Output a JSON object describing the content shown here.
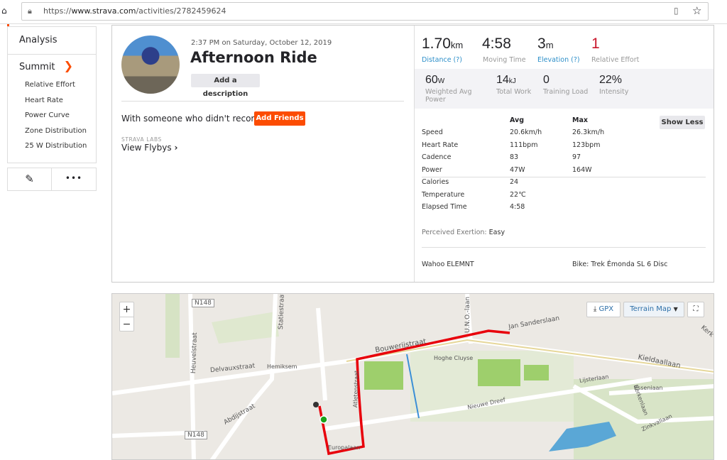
{
  "browser": {
    "url_prefix": "https://",
    "url_domain": "www.strava.com",
    "url_path": "/activities/2782459624"
  },
  "sidebar": {
    "analysis": "Analysis",
    "summit": "Summit",
    "items": [
      "Relative Effort",
      "Heart Rate",
      "Power Curve",
      "Zone Distribution",
      "25 W Distribution"
    ]
  },
  "activity": {
    "datetime": "2:37 PM on Saturday, October 12, 2019",
    "title": "Afternoon Ride",
    "add_description": "Add a description",
    "friends_prompt": "With someone who didn't record?",
    "add_friends": "Add Friends",
    "labs": "STRAVA LABS",
    "flybys": "View Flybys"
  },
  "stats": {
    "primary": [
      {
        "value": "1.70",
        "unit": "km",
        "label": "Distance (?)"
      },
      {
        "value": "4:58",
        "unit": "",
        "label": "Moving Time"
      },
      {
        "value": "3",
        "unit": "m",
        "label": "Elevation (?)"
      },
      {
        "value": "1",
        "unit": "",
        "label": "Relative Effort"
      }
    ],
    "secondary": [
      {
        "value": "60",
        "unit": "W",
        "label": "Weighted Avg Power"
      },
      {
        "value": "14",
        "unit": "kJ",
        "label": "Total Work"
      },
      {
        "value": "0",
        "unit": "",
        "label": "Training Load"
      },
      {
        "value": "22%",
        "unit": "",
        "label": "Intensity"
      }
    ],
    "table": {
      "avg": "Avg",
      "max": "Max",
      "show_less": "Show Less",
      "rows": [
        {
          "name": "Speed",
          "avg": "20.6km/h",
          "max": "26.3km/h"
        },
        {
          "name": "Heart Rate",
          "avg": "111bpm",
          "max": "123bpm"
        },
        {
          "name": "Cadence",
          "avg": "83",
          "max": "97"
        },
        {
          "name": "Power",
          "avg": "47W",
          "max": "164W"
        },
        {
          "name": "Calories",
          "avg": "24",
          "max": ""
        },
        {
          "name": "Temperature",
          "avg": "22℃",
          "max": ""
        },
        {
          "name": "Elapsed Time",
          "avg": "4:58",
          "max": ""
        }
      ]
    },
    "exertion_label": "Perceived Exertion:",
    "exertion_value": "Easy",
    "device": "Wahoo ELEMNT",
    "bike": "Bike: Trek Émonda SL 6 Disc"
  },
  "colors": {
    "accent": "#fc4c02",
    "effort": "#c9162b",
    "route": "#e8000b"
  },
  "map": {
    "zoom_in": "+",
    "zoom_out": "−",
    "gpx": "GPX",
    "map_type": "Terrain Map",
    "labels": [
      "N148",
      "Statiestraat",
      "U.N.O.-laan",
      "Jan Sanderslaan",
      "Kerk",
      "Heuvelstraat",
      "Bouwerijstraat",
      "Kieldaallaan",
      "Delvauxstraat",
      "Hemiksem",
      "Hoghe Cluyse",
      "Atletenstraat",
      "Lijsterlaan",
      "Esseniaan",
      "Abdijstraat",
      "Nieuwe Dreef",
      "Berkenlaan",
      "Zinkvallaan",
      "N148",
      "Europalaan"
    ]
  }
}
